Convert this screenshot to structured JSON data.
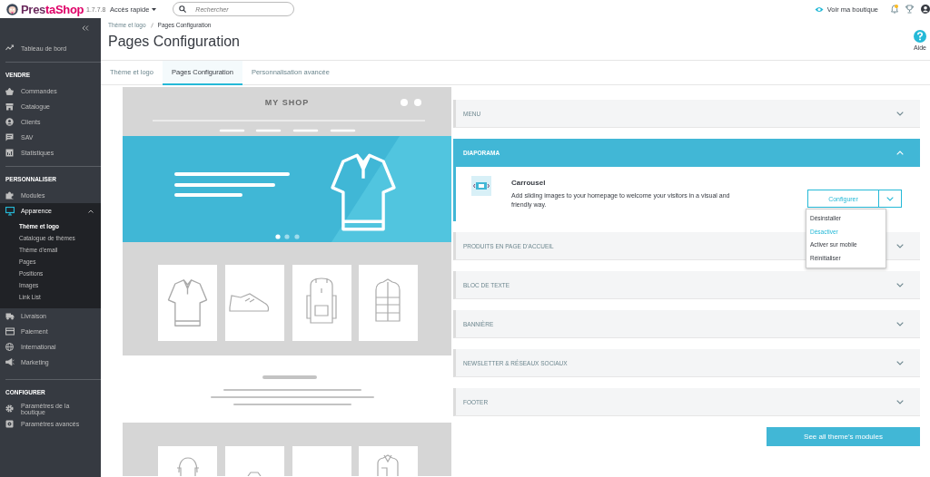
{
  "header": {
    "logo": "PrestaShop",
    "version": "1.7.7.8",
    "quick_access": "Accès rapide",
    "search": {
      "placeholder": "Rechercher"
    },
    "view_shop": "Voir ma boutique"
  },
  "sidebar": {
    "top_item": {
      "label": "Tableau de bord",
      "selected": false
    },
    "sections": [
      {
        "title": "VENDRE",
        "items": [
          {
            "label": "Commandes",
            "selected": false,
            "expanded": false
          },
          {
            "label": "Catalogue",
            "selected": false,
            "expanded": false
          },
          {
            "label": "Clients",
            "selected": false,
            "expanded": false
          },
          {
            "label": "SAV",
            "selected": false,
            "expanded": false
          },
          {
            "label": "Statistiques",
            "selected": false,
            "expanded": false
          }
        ]
      },
      {
        "title": "PERSONNALISER",
        "items": [
          {
            "label": "Modules",
            "selected": false,
            "expanded": false
          },
          {
            "label": "Apparence",
            "selected": true,
            "expanded": true,
            "children": [
              {
                "label": "Thème et logo",
                "selected": true
              },
              {
                "label": "Catalogue de thèmes",
                "selected": false
              },
              {
                "label": "Thème d'email",
                "selected": false
              },
              {
                "label": "Pages",
                "selected": false
              },
              {
                "label": "Positions",
                "selected": false
              },
              {
                "label": "Images",
                "selected": false
              },
              {
                "label": "Link List",
                "selected": false
              }
            ]
          },
          {
            "label": "Livraison",
            "selected": false,
            "expanded": false
          },
          {
            "label": "Paiement",
            "selected": false,
            "expanded": false
          },
          {
            "label": "International",
            "selected": false,
            "expanded": false
          },
          {
            "label": "Marketing",
            "selected": false,
            "expanded": false
          }
        ]
      },
      {
        "title": "CONFIGURER",
        "items": [
          {
            "label": "Paramètres de la boutique",
            "selected": false,
            "expanded": false
          },
          {
            "label": "Paramètres avancés",
            "selected": false,
            "expanded": false
          }
        ]
      }
    ]
  },
  "page": {
    "breadcrumb": [
      "Thème et logo",
      "Pages Configuration"
    ],
    "title": "Pages Configuration",
    "help": "Aide",
    "tabs": [
      {
        "label": "Thème et logo",
        "selected": false
      },
      {
        "label": "Pages Configuration",
        "selected": true
      },
      {
        "label": "Personnalisation avancée",
        "selected": false
      }
    ]
  },
  "preview": {
    "shop_name": "MY SHOP"
  },
  "panels": [
    {
      "title": "MENU",
      "expanded": false
    },
    {
      "title": "DIAPORAMA",
      "expanded": true,
      "module": {
        "name": "Carrousel",
        "description": "Add sliding images to your homepage to welcome your visitors in a visual and friendly way.",
        "configure": "Configurer",
        "menu_open": true,
        "actions": [
          {
            "label": "Désinstaller",
            "highlighted": false
          },
          {
            "label": "Désactiver",
            "highlighted": true
          },
          {
            "label": "Activer sur mobile",
            "highlighted": false
          },
          {
            "label": "Réinitialiser",
            "highlighted": false
          }
        ]
      }
    },
    {
      "title": "PRODUITS EN PAGE D'ACCUEIL",
      "expanded": false
    },
    {
      "title": "BLOC DE TEXTE",
      "expanded": false
    },
    {
      "title": "BANNIÈRE",
      "expanded": false
    },
    {
      "title": "NEWSLETTER & RÉSEAUX SOCIAUX",
      "expanded": false
    },
    {
      "title": "FOOTER",
      "expanded": false
    }
  ],
  "see_all": "See all theme's modules"
}
